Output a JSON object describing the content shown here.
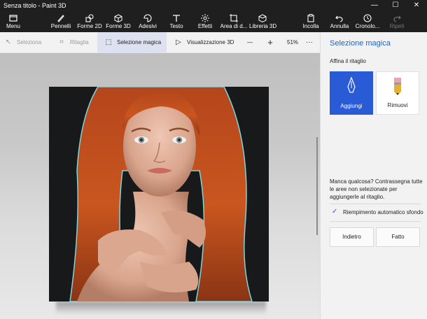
{
  "window": {
    "title": "Senza titolo - Paint 3D",
    "controls": {
      "minimize": "—",
      "maximize": "☐",
      "close": "✕"
    }
  },
  "ribbon": {
    "menu": "Menu",
    "tools": [
      {
        "label": "Pennelli",
        "icon": "brush-icon"
      },
      {
        "label": "Forme 2D",
        "icon": "shapes-2d-icon"
      },
      {
        "label": "Forme 3D",
        "icon": "cube-icon"
      },
      {
        "label": "Adesivi",
        "icon": "sticker-icon"
      },
      {
        "label": "Testo",
        "icon": "text-icon"
      },
      {
        "label": "Effetti",
        "icon": "effects-icon"
      },
      {
        "label": "Area di d...",
        "icon": "canvas-icon"
      },
      {
        "label": "Libreria 3D",
        "icon": "library-3d-icon"
      }
    ],
    "right": [
      {
        "label": "Incolla",
        "icon": "paste-icon"
      },
      {
        "label": "Annulla",
        "icon": "undo-icon"
      },
      {
        "label": "Cronolo...",
        "icon": "history-icon"
      },
      {
        "label": "Ripeti",
        "icon": "redo-icon"
      }
    ]
  },
  "toolbar": {
    "select": "Seleziona",
    "crop": "Ritaglia",
    "magic_select": "Selezione magica",
    "view_3d": "Visualizzazione 3D",
    "zoom_out": "—",
    "zoom_in": "+",
    "zoom": "51%",
    "more": "···"
  },
  "panel": {
    "title": "Selezione magica",
    "subtitle": "Affina il ritaglio",
    "add": "Aggiungi",
    "remove": "Rimuovi",
    "hint": "Manca qualcosa? Contrassegna tutte le aree non selezionate per aggiungerle al ritaglio.",
    "autofill": "Riempimento automatico sfondo",
    "autofill_checked": true,
    "back": "Indietro",
    "done": "Fatto"
  },
  "colors": {
    "accent": "#2a5bd7",
    "ribbon_bg": "#1f1f1f",
    "panel_bg": "#f2f2f2",
    "selection_outline": "#7fd6dc"
  }
}
